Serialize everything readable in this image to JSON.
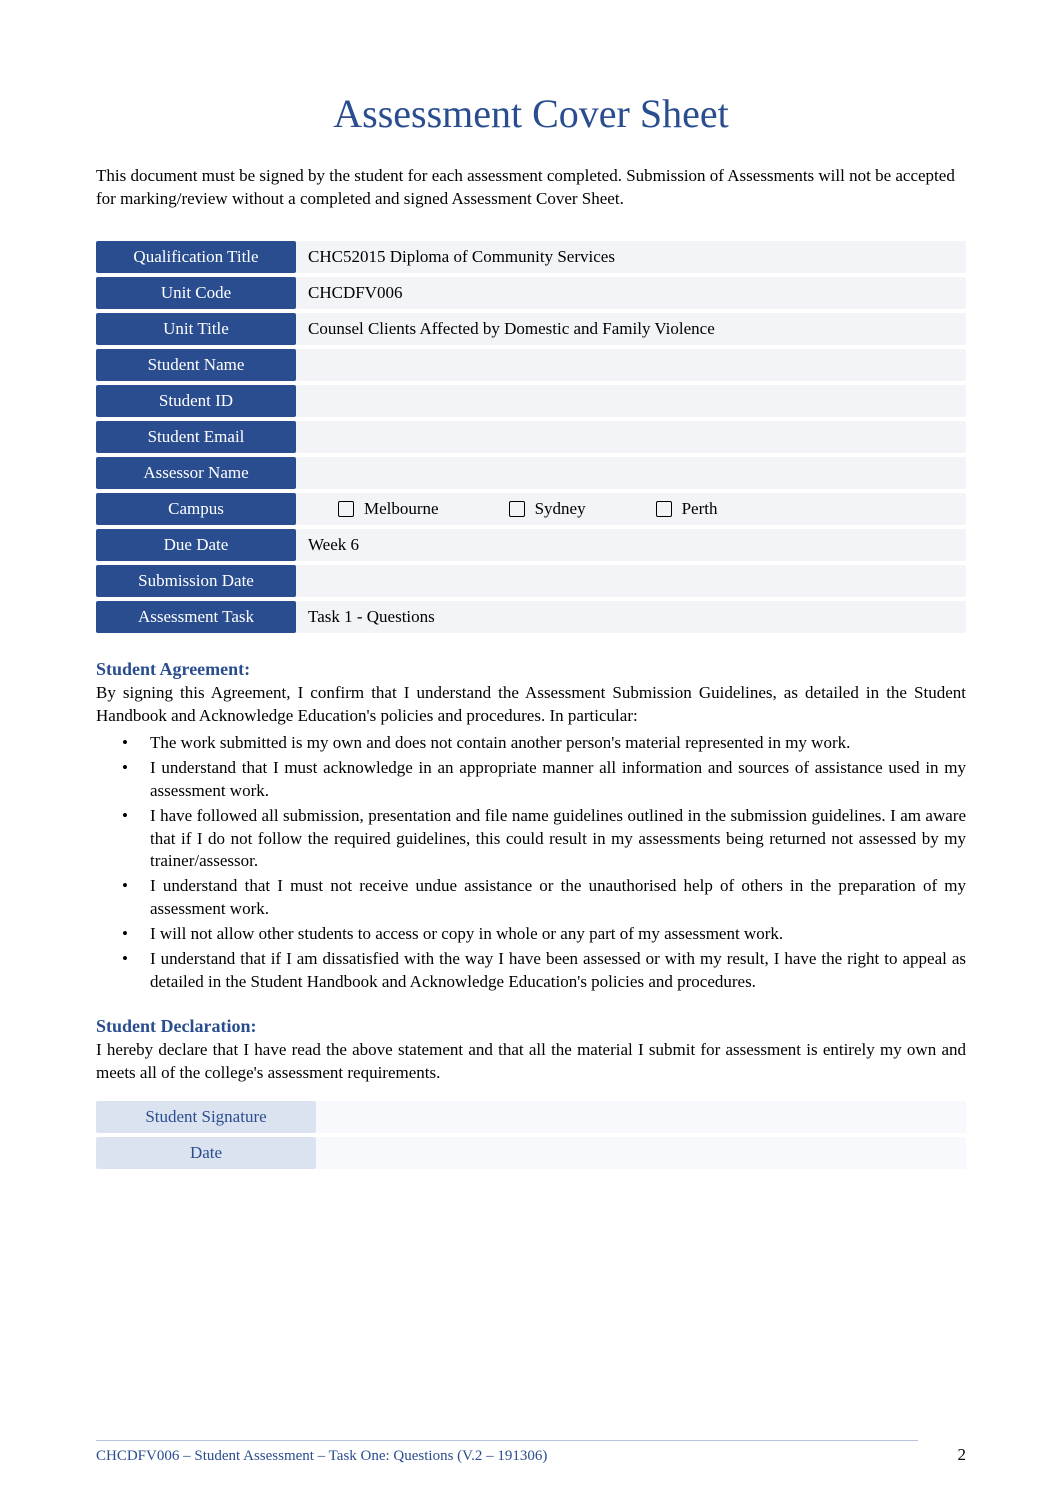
{
  "title": "Assessment Cover Sheet",
  "intro": "This document must be signed by the student for each assessment completed. Submission of Assessments will not be accepted for marking/review without a completed and signed Assessment Cover Sheet.",
  "info": {
    "qualification_title_label": "Qualification Title",
    "qualification_title_value": "CHC52015 Diploma of Community Services",
    "unit_code_label": "Unit Code",
    "unit_code_value": "CHCDFV006",
    "unit_title_label": "Unit Title",
    "unit_title_value": "Counsel Clients Affected by Domestic and Family Violence",
    "student_name_label": "Student Name",
    "student_name_value": "",
    "student_id_label": "Student ID",
    "student_id_value": "",
    "student_email_label": "Student Email",
    "student_email_value": "",
    "assessor_name_label": "Assessor Name",
    "assessor_name_value": "",
    "campus_label": "Campus",
    "campus_options": {
      "melbourne": "Melbourne",
      "sydney": "Sydney",
      "perth": "Perth"
    },
    "due_date_label": "Due Date",
    "due_date_value": "Week 6",
    "submission_date_label": "Submission Date",
    "submission_date_value": "",
    "assessment_task_label": "Assessment Task",
    "assessment_task_value": "Task 1 - Questions"
  },
  "agreement": {
    "heading": "Student Agreement:",
    "intro": "By signing this Agreement, I confirm that I understand the Assessment Submission Guidelines, as detailed in the Student Handbook and Acknowledge Education's policies and procedures. In particular:",
    "bullets": [
      "The work submitted is my own and does not contain another person's material represented in my work.",
      "I understand that I must acknowledge in an appropriate manner all information and sources of assistance used in my assessment work.",
      "I have followed all submission, presentation and file name guidelines outlined in the submission guidelines. I am aware that if I do not follow the required guidelines, this could result in my assessments being returned not assessed by my trainer/assessor.",
      "I understand that I must not receive undue assistance or the unauthorised help of others in the preparation of my assessment work.",
      "I will not allow other students to access or copy in whole or any part of my assessment work.",
      "I understand that if I am dissatisfied with the way I have been assessed or with my result, I have the right to appeal as detailed in the Student Handbook and Acknowledge Education's policies and procedures."
    ]
  },
  "declaration": {
    "heading": "Student Declaration:",
    "text": "I hereby declare that I have read the above statement and that all the material I submit for assessment is entirely my own and meets all of the college's assessment requirements."
  },
  "signature": {
    "signature_label": "Student Signature",
    "signature_value": "",
    "date_label": "Date",
    "date_value": ""
  },
  "footer": {
    "text": "CHCDFV006 – Student Assessment – Task One: Questions (V.2 – 191306)",
    "page": "2"
  }
}
